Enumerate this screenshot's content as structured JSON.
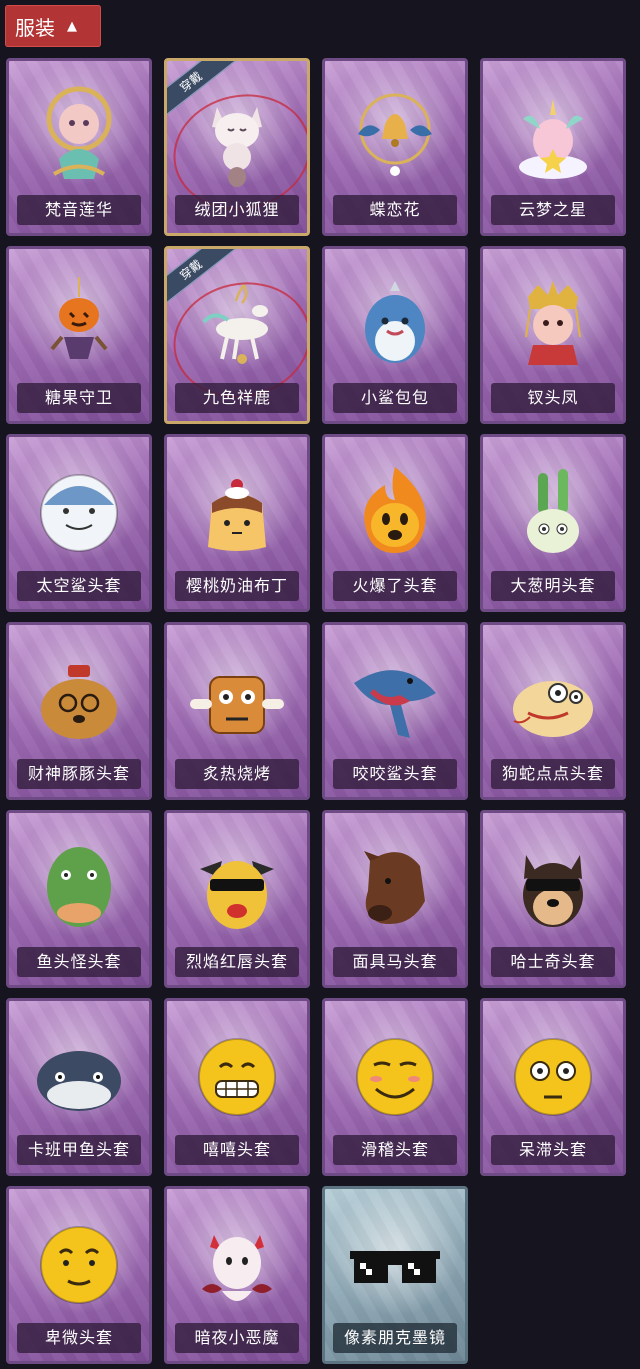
{
  "header": {
    "tab_label": "服装",
    "chevron_icon": "chevron-up-icon"
  },
  "worn_badge_text": "穿戴",
  "items": [
    {
      "name": "梵音莲华",
      "icon": "lotus-girl-icon",
      "worn": false
    },
    {
      "name": "绒团小狐狸",
      "icon": "fox-icon",
      "worn": true
    },
    {
      "name": "蝶恋花",
      "icon": "bell-charm-icon",
      "worn": false
    },
    {
      "name": "云梦之星",
      "icon": "unicorn-icon",
      "worn": false
    },
    {
      "name": "糖果守卫",
      "icon": "pumpkin-icon",
      "worn": false
    },
    {
      "name": "九色祥鹿",
      "icon": "deer-icon",
      "worn": true
    },
    {
      "name": "小鲨包包",
      "icon": "shark-plush-icon",
      "worn": false
    },
    {
      "name": "钗头凤",
      "icon": "crown-girl-icon",
      "worn": false
    },
    {
      "name": "太空鲨头套",
      "icon": "space-shark-head-icon",
      "worn": false
    },
    {
      "name": "樱桃奶油布丁",
      "icon": "pudding-icon",
      "worn": false
    },
    {
      "name": "火爆了头套",
      "icon": "fire-head-icon",
      "worn": false
    },
    {
      "name": "大葱明头套",
      "icon": "scallion-head-icon",
      "worn": false
    },
    {
      "name": "财神豚豚头套",
      "icon": "capybara-head-icon",
      "worn": false
    },
    {
      "name": "炙热烧烤",
      "icon": "bbq-meat-icon",
      "worn": false
    },
    {
      "name": "咬咬鲨头套",
      "icon": "biting-shark-icon",
      "worn": false
    },
    {
      "name": "狗蛇点点头套",
      "icon": "snake-head-icon",
      "worn": false
    },
    {
      "name": "鱼头怪头套",
      "icon": "fish-head-icon",
      "worn": false
    },
    {
      "name": "烈焰红唇头套",
      "icon": "yellow-mask-icon",
      "worn": false
    },
    {
      "name": "面具马头套",
      "icon": "horse-head-icon",
      "worn": false
    },
    {
      "name": "哈士奇头套",
      "icon": "husky-head-icon",
      "worn": false
    },
    {
      "name": "卡班甲鱼头套",
      "icon": "whale-head-icon",
      "worn": false
    },
    {
      "name": "嘻嘻头套",
      "icon": "grin-emoji-icon",
      "worn": false
    },
    {
      "name": "滑稽头套",
      "icon": "funny-emoji-icon",
      "worn": false
    },
    {
      "name": "呆滞头套",
      "icon": "stare-emoji-icon",
      "worn": false
    },
    {
      "name": "卑微头套",
      "icon": "humble-emoji-icon",
      "worn": false
    },
    {
      "name": "暗夜小恶魔",
      "icon": "devil-icon",
      "worn": false
    },
    {
      "name": "像素朋克墨镜",
      "icon": "pixel-sunglasses-icon",
      "worn": false
    }
  ],
  "colors": {
    "background": "#16151f",
    "card_purple": "#9f6cb4",
    "card_blue": "#8ea8b5",
    "tab_red": "#b33434",
    "worn_border": "#c9a86a"
  }
}
